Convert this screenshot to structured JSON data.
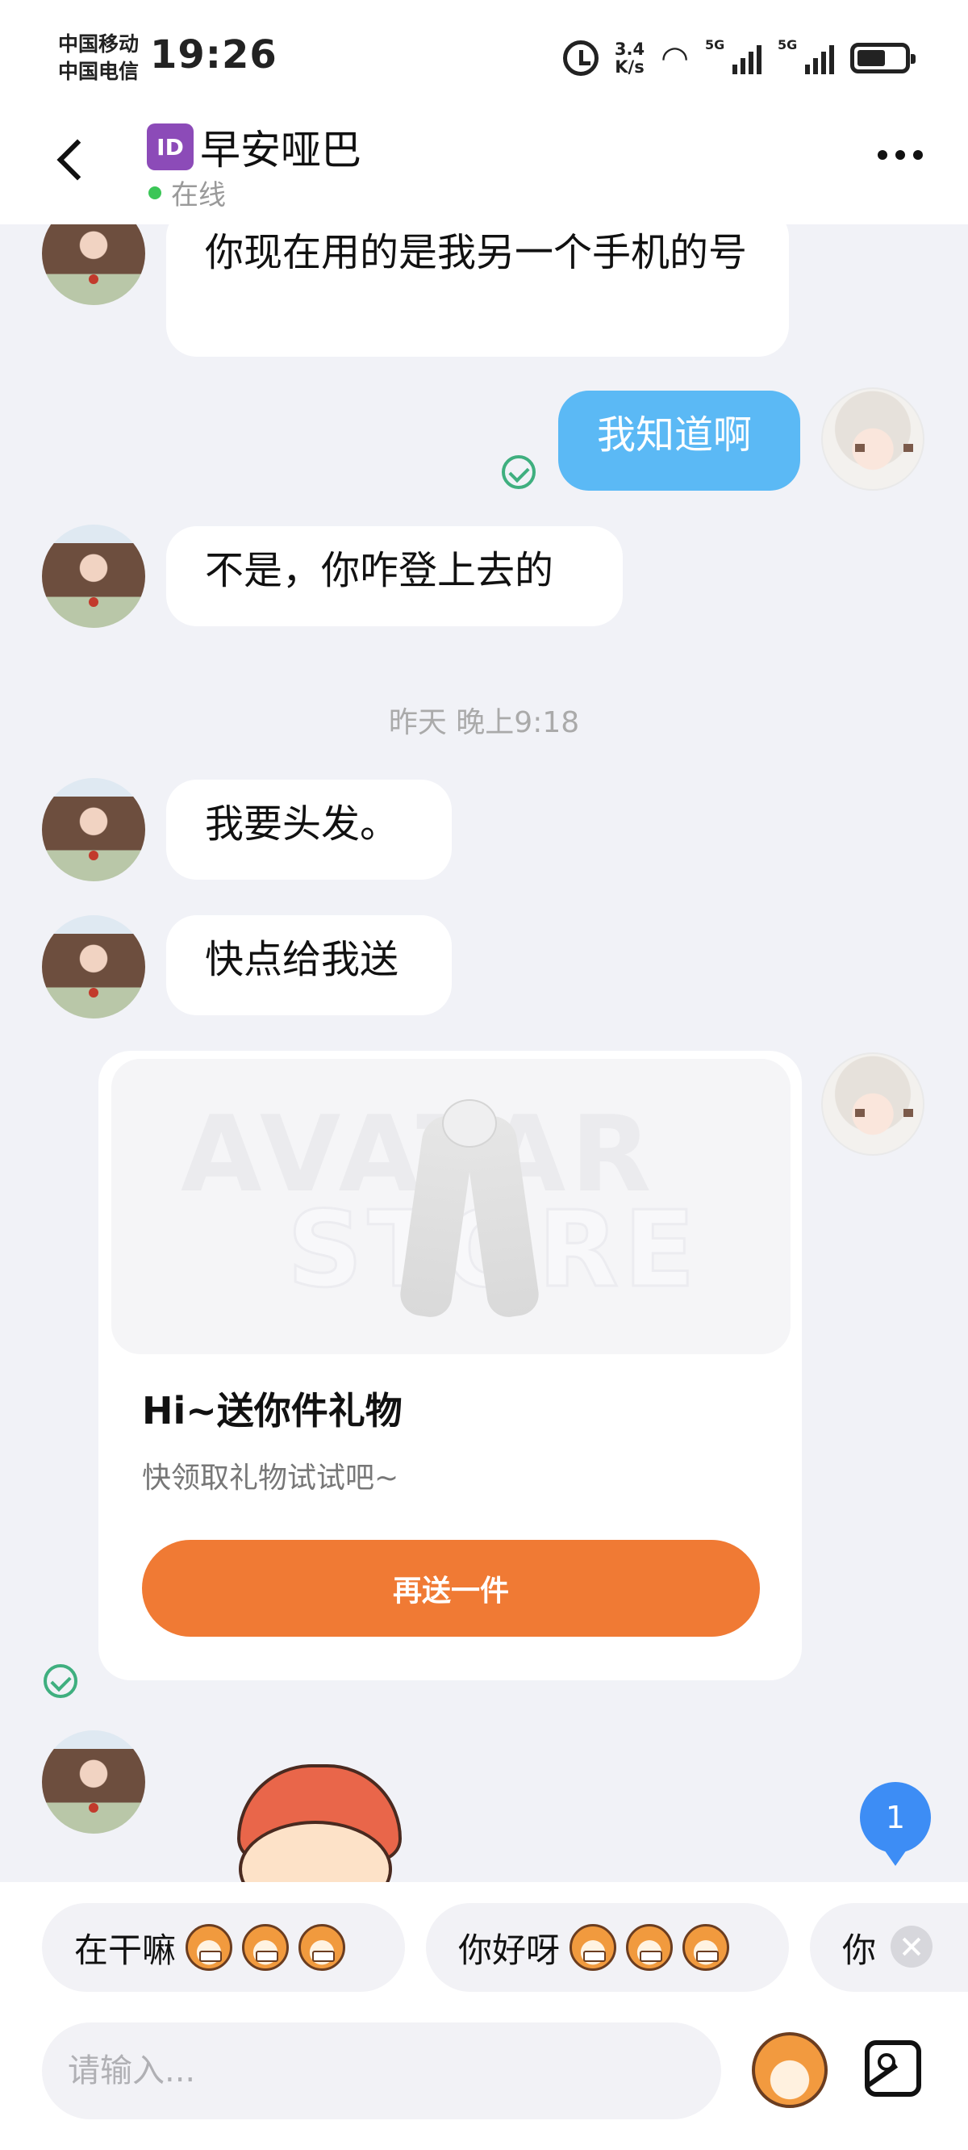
{
  "status_bar": {
    "carrier_1": "中国移动",
    "carrier_2": "中国电信",
    "time": "19:26",
    "net_speed_value": "3.4",
    "net_speed_unit": "K/s",
    "signal_1_label": "5G",
    "signal_2_label": "5G",
    "battery_level": 0.6
  },
  "header": {
    "id_badge": "ID",
    "title": "早安哑巴",
    "status": "在线"
  },
  "messages": [
    {
      "side": "in",
      "text": "你现在用的是我另一个手机的号"
    },
    {
      "side": "out",
      "text": "我知道啊"
    },
    {
      "side": "in",
      "text": "不是，你咋登上去的"
    },
    {
      "type": "timestamp",
      "text": "昨天 晚上9:18"
    },
    {
      "side": "in",
      "text": "我要头发。"
    },
    {
      "side": "in",
      "text": "快点给我送"
    }
  ],
  "gift_card": {
    "watermark_line_1": "AVATAR",
    "watermark_line_2": "STORE",
    "title": "Hi~送你件礼物",
    "subtitle": "快领取礼物试试吧~",
    "button": "再送一件"
  },
  "unread_badge": "1",
  "quick_replies": [
    {
      "text": "在干嘛"
    },
    {
      "text": "你好呀"
    },
    {
      "text": "你"
    }
  ],
  "input": {
    "placeholder": "请输入..."
  },
  "colors": {
    "bubble_out": "#5bb9f5",
    "gift_button": "#f07a34",
    "online_dot": "#3bc657",
    "read_check": "#3faf7f",
    "badge": "#3d8df5"
  }
}
